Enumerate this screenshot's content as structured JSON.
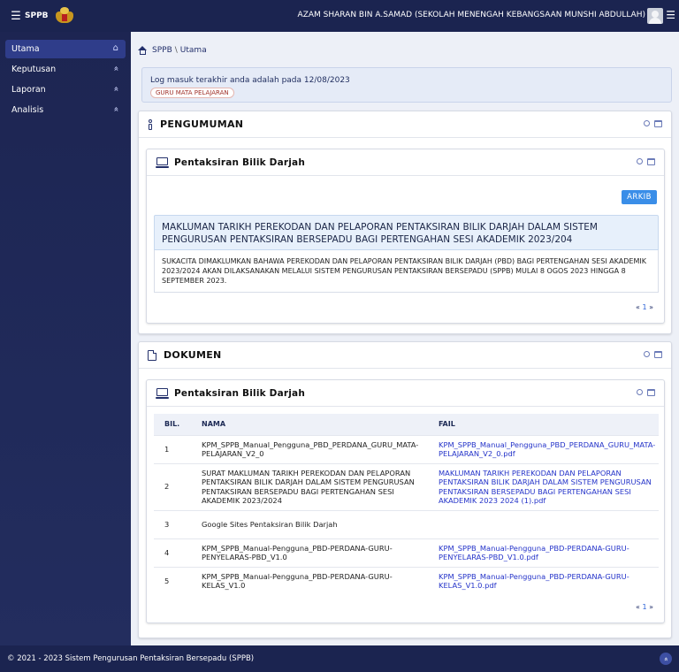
{
  "topbar": {
    "brand": "SPPB",
    "menu_icon": "hamburger-icon",
    "crest_icon": "crest-icon",
    "user_label": "AZAM SHARAN BIN A.SAMAD (SEKOLAH MENENGAH KEBANGSAAN MUNSHI ABDULLAH)",
    "avatar_icon": "avatar-icon"
  },
  "sidebar": {
    "items": [
      {
        "label": "Utama",
        "icon": "home-icon",
        "glyph": "⌂",
        "active": true
      },
      {
        "label": "Keputusan",
        "icon": "chevron-up-icon",
        "glyph": "«",
        "active": false
      },
      {
        "label": "Laporan",
        "icon": "chevron-up-icon",
        "glyph": "«",
        "active": false
      },
      {
        "label": "Analisis",
        "icon": "chevron-up-icon",
        "glyph": "«",
        "active": false
      }
    ]
  },
  "breadcrumb": {
    "root": "SPPB",
    "separator": "\\",
    "current": "Utama"
  },
  "login": {
    "message": "Log masuk terakhir anda adalah pada 12/08/2023",
    "role": "GURU MATA PELAJARAN"
  },
  "announcements": {
    "title": "PENGUMUMAN",
    "sub_title": "Pentaksiran Bilik Darjah",
    "archive_label": "ARKIB",
    "item_title": "MAKLUMAN TARIKH PEREKODAN DAN PELAPORAN PENTAKSIRAN BILIK DARJAH DALAM SISTEM PENGURUSAN PENTAKSIRAN BERSEPADU BAGI PERTENGAHAN SESI AKADEMIK 2023/204",
    "item_body": "SUKACITA DIMAKLUMKAN BAHAWA PEREKODAN DAN PELAPORAN PENTAKSIRAN BILIK DARJAH (PBD) BAGI PERTENGAHAN SESI AKADEMIK 2023/2024 AKAN DILAKSANAKAN MELALUI SISTEM PENGURUSAN PENTAKSIRAN BERSEPADU (SPPB) MULAI 8 OGOS 2023 HINGGA 8 SEPTEMBER 2023.",
    "pager": {
      "prev": "«",
      "current": "1",
      "next": "»"
    }
  },
  "documents": {
    "title": "DOKUMEN",
    "sub_title": "Pentaksiran Bilik Darjah",
    "columns": {
      "bil": "BIL.",
      "nama": "NAMA",
      "fail": "FAIL"
    },
    "rows": [
      {
        "bil": "1",
        "nama": "KPM_SPPB_Manual_Pengguna_PBD_PERDANA_GURU_MATA-PELAJARAN_V2_0",
        "fail": "KPM_SPPB_Manual_Pengguna_PBD_PERDANA_GURU_MATA-PELAJARAN_V2_0.pdf"
      },
      {
        "bil": "2",
        "nama": "SURAT MAKLUMAN TARIKH PEREKODAN DAN PELAPORAN PENTAKSIRAN BILIK DARJAH DALAM SISTEM PENGURUSAN PENTAKSIRAN BERSEPADU BAGI PERTENGAHAN SESI AKADEMIK 2023/2024",
        "fail": "MAKLUMAN TARIKH PEREKODAN DAN PELAPORAN PENTAKSIRAN BILIK DARJAH DALAM SISTEM PENGURUSAN PENTAKSIRAN BERSEPADU BAGI PERTENGAHAN SESI AKADEMIK 2023 2024 (1).pdf"
      },
      {
        "bil": "3",
        "nama": "Google Sites Pentaksiran Bilik Darjah",
        "fail": ""
      },
      {
        "bil": "4",
        "nama": "KPM_SPPB_Manual-Pengguna_PBD-PERDANA-GURU-PENYELARAS-PBD_V1.0",
        "fail": "KPM_SPPB_Manual-Pengguna_PBD-PERDANA-GURU-PENYELARAS-PBD_V1.0.pdf"
      },
      {
        "bil": "5",
        "nama": "KPM_SPPB_Manual-Pengguna_PBD-PERDANA-GURU-KELAS_V1.0",
        "fail": "KPM_SPPB_Manual-Pengguna_PBD-PERDANA-GURU-KELAS_V1.0.pdf"
      }
    ],
    "pager": {
      "prev": "«",
      "current": "1",
      "next": "»"
    }
  },
  "footer": {
    "text": "© 2021 - 2023 Sistem Pengurusan Pentaksiran Bersepadu (SPPB)",
    "scroll_top": "«"
  }
}
